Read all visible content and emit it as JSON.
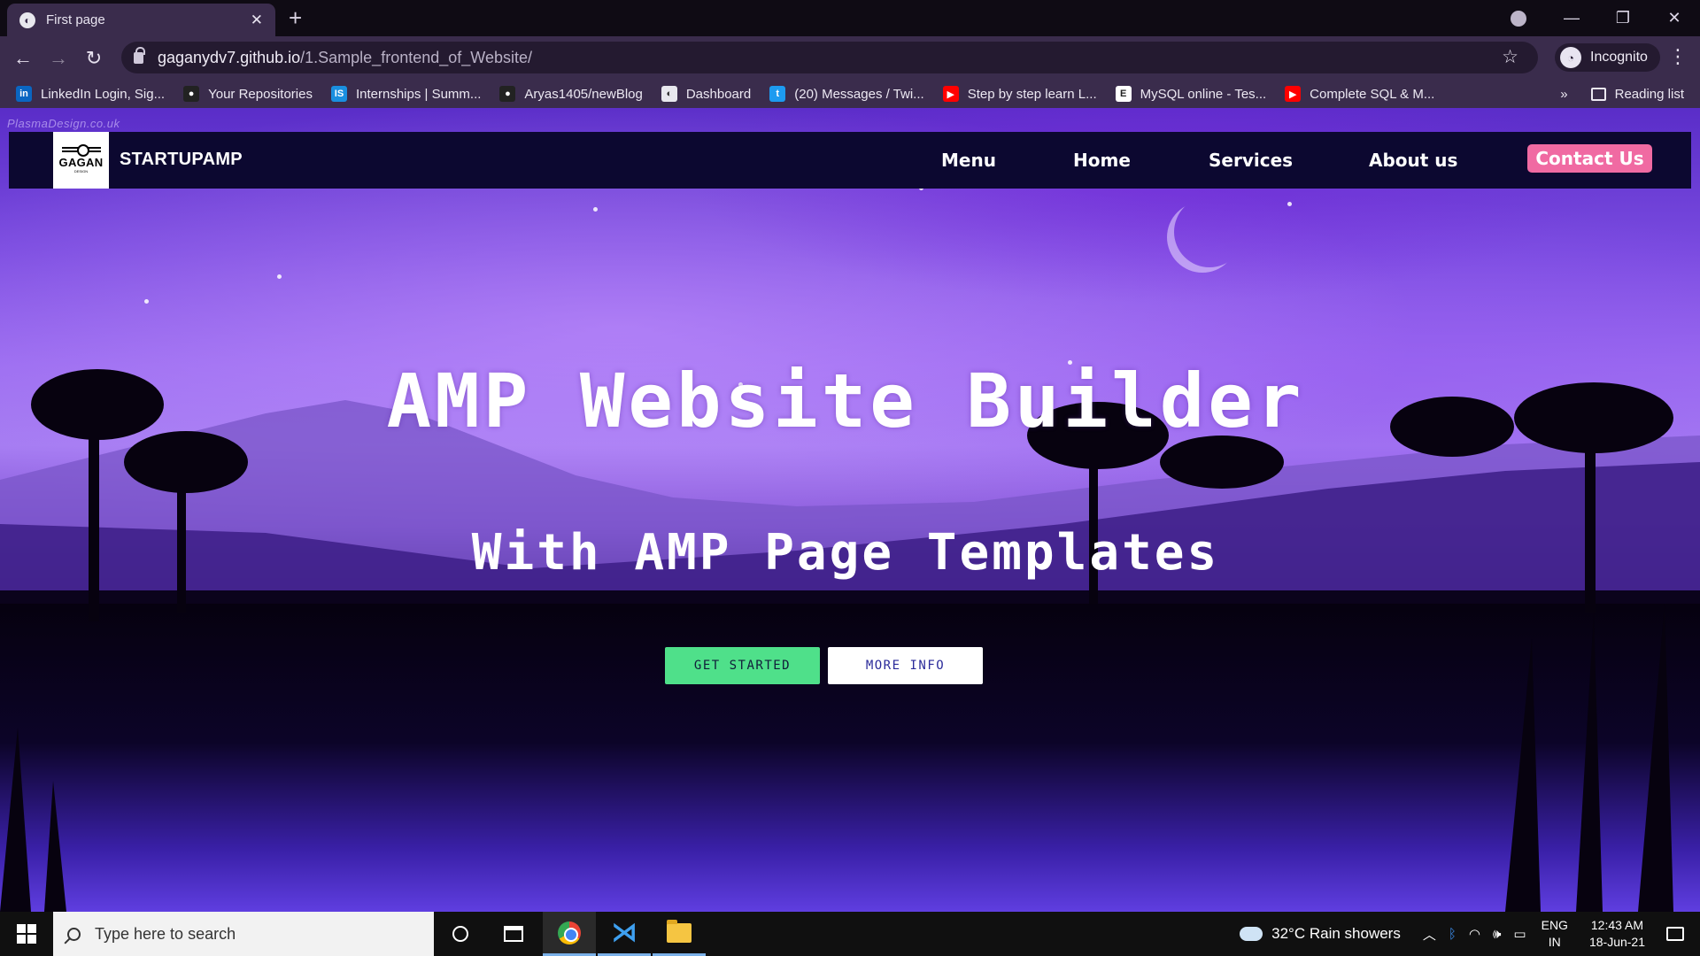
{
  "browser": {
    "tab_title": "First page",
    "url_host": "gaganydv7.github.io",
    "url_path": "/1.Sample_frontend_of_Website/",
    "profile_label": "Incognito",
    "reading_list": "Reading list",
    "bookmarks": [
      {
        "label": "LinkedIn Login, Sig...",
        "icon": "linkedin-icon",
        "color": "#0a66c2",
        "glyph": "in"
      },
      {
        "label": "Your Repositories",
        "icon": "github-icon",
        "color": "#222222",
        "glyph": "●"
      },
      {
        "label": "Internships | Summ...",
        "icon": "internshala-icon",
        "color": "#1a8fe0",
        "glyph": "IS"
      },
      {
        "label": "Aryas1405/newBlog",
        "icon": "github-icon",
        "color": "#222222",
        "glyph": "●"
      },
      {
        "label": "Dashboard",
        "icon": "globe-icon",
        "color": "#e8e8ee",
        "glyph": "◐"
      },
      {
        "label": "(20) Messages / Twi...",
        "icon": "twitter-icon",
        "color": "#1d9bf0",
        "glyph": "t"
      },
      {
        "label": "Step by step learn L...",
        "icon": "youtube-icon",
        "color": "#ff0000",
        "glyph": "▶"
      },
      {
        "label": "MySQL online - Tes...",
        "icon": "e-icon",
        "color": "#ffffff",
        "glyph": "E"
      },
      {
        "label": "Complete SQL & M...",
        "icon": "youtube-icon",
        "color": "#ff0000",
        "glyph": "▶"
      }
    ]
  },
  "page": {
    "watermark": "PlasmaDesign.co.uk",
    "logo_text": "GAGAN",
    "logo_sub": "DESIGN",
    "brand": "STARTUPAMP",
    "nav": {
      "menu": "Menu",
      "home": "Home",
      "services": "Services",
      "about": "About us",
      "contact": "Contact Us"
    },
    "hero_title": "AMP Website Builder",
    "hero_subtitle": "With AMP Page Templates",
    "buttons": {
      "get_started": "GET STARTED",
      "more_info": "MORE INFO"
    },
    "colors": {
      "navbar": "#0c0830",
      "contact": "#f06aa2",
      "get_started": "#4fe08a"
    }
  },
  "taskbar": {
    "search_placeholder": "Type here to search",
    "weather": "32°C  Rain showers",
    "lang_top": "ENG",
    "lang_bottom": "IN",
    "time": "12:43 AM",
    "date": "18-Jun-21"
  }
}
